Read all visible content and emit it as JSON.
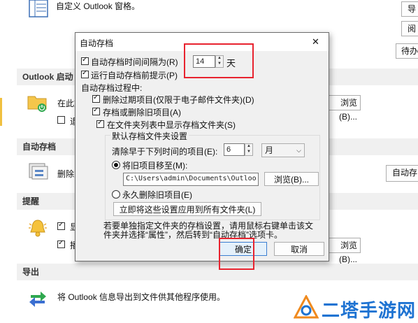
{
  "background": {
    "top_text": "自定义 Outlook 窗格。",
    "right_buttons": [
      "导",
      "阅",
      "待办"
    ],
    "sections": {
      "outlook_start": "Outlook 启动",
      "autoarchive": "自动存档",
      "reminders": "提醒",
      "export": "导出"
    },
    "start_row1_partial": "在此文",
    "start_row2_partial": "退",
    "start_browse_btn": "浏览(B)...",
    "archive_partial": "删除或",
    "archive_btn": "自动存",
    "reminder_row1_partial": "显",
    "reminder_row2_partial": "播",
    "reminder_browse_btn": "浏览(B)...",
    "export_text": "将 Outlook 信息导出到文件供其他程序使用。"
  },
  "dialog": {
    "title": "自动存档",
    "close_glyph": "✕",
    "run_every_label": "自动存档时间间隔为(R)",
    "run_every_value": "14",
    "run_every_unit": "天",
    "prompt_label": "运行自动存档前提示(P)",
    "during_label": "自动存档过程中:",
    "delete_expired_label": "删除过期项目(仅限于电子邮件文件夹)(D)",
    "archive_delete_label": "存档或删除旧项目(A)",
    "show_folder_label": "在文件夹列表中显示存档文件夹(S)",
    "default_group_label": "默认存档文件夹设置",
    "clean_older_label": "清除早于下列时间的项目(E):",
    "clean_older_value": "6",
    "clean_older_unit": "月",
    "move_label": "将旧项目移至(M):",
    "move_path": "C:\\Users\\admin\\Documents\\Outloo",
    "browse_btn": "浏览(B)...",
    "perm_delete_label": "永久删除旧项目(E)",
    "apply_all_btn": "立即将这些设置应用到所有文件夹(L)",
    "hint_text": "若要单独指定文件夹的存档设置，请用鼠标右键单击该文件夹并选择“属性”，然后转到“自动存档”选项卡。",
    "ok_btn": "确定",
    "cancel_btn": "取消"
  },
  "watermark": {
    "text": "二塔手游网"
  },
  "colors": {
    "highlight_red": "#e8232f",
    "watermark_blue": "#1e73d2",
    "watermark_orange": "#f08a1e"
  }
}
